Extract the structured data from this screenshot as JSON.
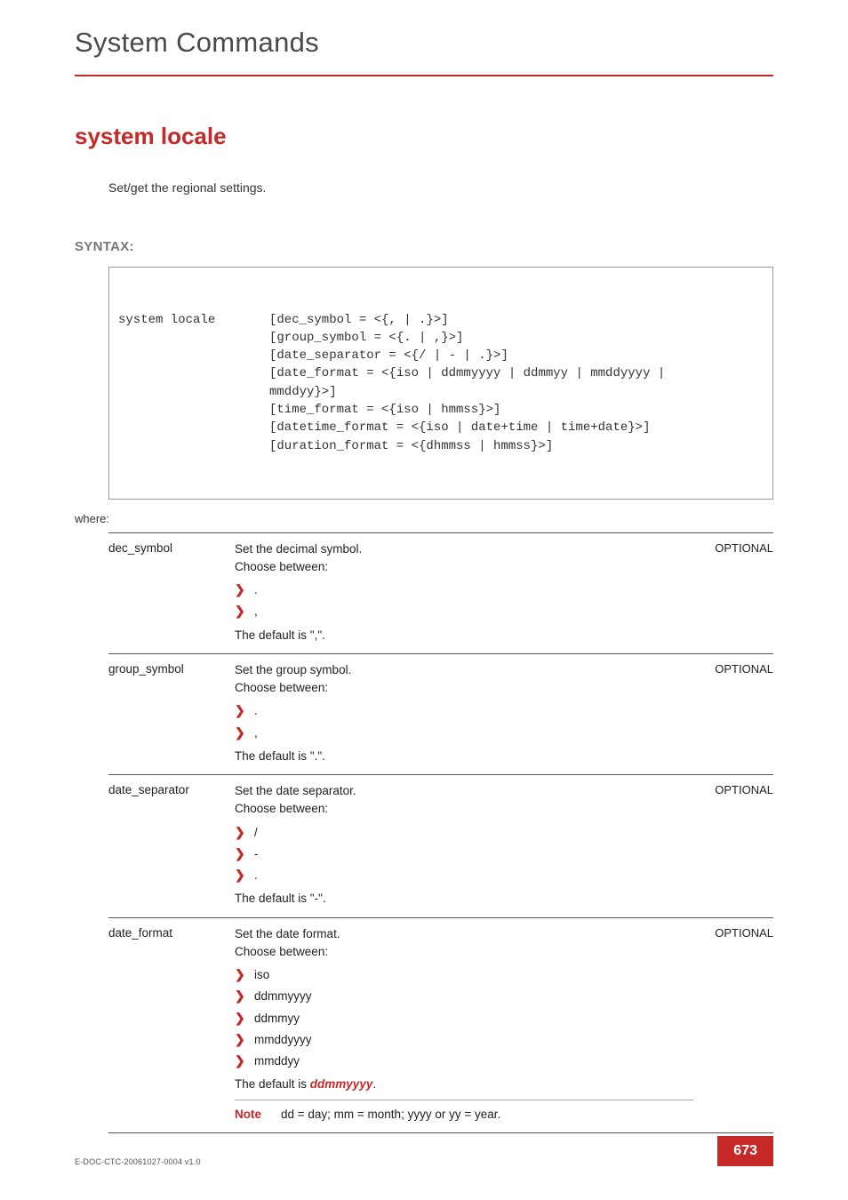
{
  "header": {
    "title": "System Commands"
  },
  "command": {
    "title": "system locale",
    "description": "Set/get the regional settings."
  },
  "syntax": {
    "label": "SYNTAX:",
    "command": "system locale",
    "body": "[dec_symbol = <{, | .}>]\n[group_symbol = <{. | ,}>]\n[date_separator = <{/ | - | .}>]\n[date_format = <{iso | ddmmyyyy | ddmmyy | mmddyyyy |\nmmddyy}>]\n[time_format = <{iso | hmmss}>]\n[datetime_format = <{iso | date+time | time+date}>]\n[duration_format = <{dhmmss | hmmss}>]"
  },
  "where_label": "where:",
  "params": [
    {
      "name": "dec_symbol",
      "intro1": "Set the decimal symbol.",
      "intro2": "Choose between:",
      "options": [
        ".",
        ","
      ],
      "default_text": "The default is \",\".",
      "flag": "OPTIONAL"
    },
    {
      "name": "group_symbol",
      "intro1": "Set the group symbol.",
      "intro2": "Choose between:",
      "options": [
        ".",
        ","
      ],
      "default_text": "The default is \".\".",
      "flag": "OPTIONAL"
    },
    {
      "name": "date_separator",
      "intro1": "Set the date separator.",
      "intro2": "Choose between:",
      "options": [
        "/",
        "-",
        "."
      ],
      "default_text": "The default is \"-\".",
      "flag": "OPTIONAL"
    },
    {
      "name": "date_format",
      "intro1": "Set the date format.",
      "intro2": "Choose between:",
      "options": [
        "iso",
        "ddmmyyyy",
        "ddmmyy",
        "mmddyyyy",
        "mmddyy"
      ],
      "default_prefix": "The default is ",
      "default_value": "ddmmyyyy",
      "default_suffix": ".",
      "note_label": "Note",
      "note_text": "dd = day; mm = month; yyyy or yy = year.",
      "flag": "OPTIONAL"
    }
  ],
  "footer": {
    "doc_id": "E-DOC-CTC-20061027-0004 v1.0",
    "page_number": "673"
  }
}
